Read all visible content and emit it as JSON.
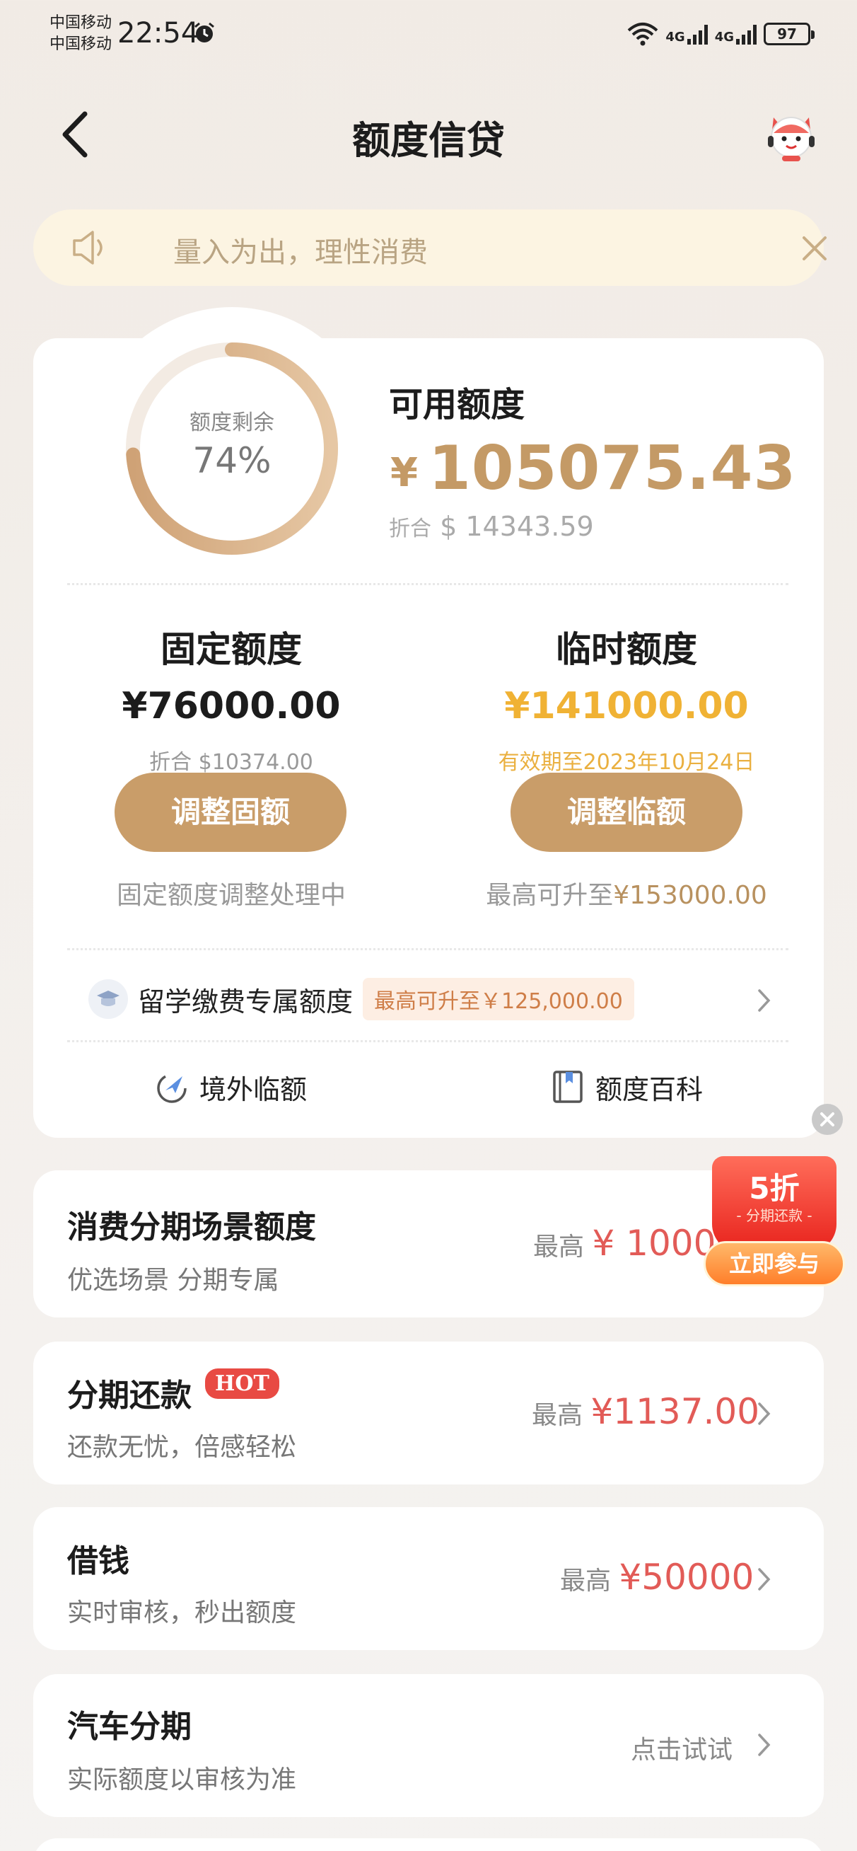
{
  "status_bar": {
    "carrier_1": "中国移动",
    "carrier_2": "中国移动",
    "time": "22:54",
    "net_1": "4G",
    "net_2": "4G",
    "battery": "97"
  },
  "nav": {
    "title": "额度信贷"
  },
  "notice": {
    "text": "量入为出，理性消费"
  },
  "overview": {
    "ring_label": "额度剩余",
    "ring_percent": "74%",
    "ring_fraction": 0.74,
    "available_label": "可用额度",
    "currency": "¥",
    "available_amount": "105075.43",
    "usd_prefix": "折合",
    "usd_amount": "$ 14343.59"
  },
  "fixed": {
    "title": "固定额度",
    "amount": "¥76000.00",
    "usd": "折合 $10374.00",
    "button": "调整固额",
    "note": "固定额度调整处理中"
  },
  "temporary": {
    "title": "临时额度",
    "amount": "¥141000.00",
    "validity_prefix": "有效期至",
    "validity_date": "2023年10月24日",
    "button": "调整临额",
    "note_prefix": "最高可升至",
    "note_amount": "¥153000.00"
  },
  "study_abroad": {
    "label": "留学缴费专属额度",
    "tag": "最高可升至￥125,000.00"
  },
  "links": {
    "overseas": "境外临额",
    "wiki": "额度百科"
  },
  "rows": [
    {
      "title": "消费分期场景额度",
      "subtitle": "优选场景 分期专属",
      "prefix": "最高",
      "amount": "¥ 10000"
    },
    {
      "title": "分期还款",
      "badge": "HOT",
      "subtitle": "还款无忧，倍感轻松",
      "prefix": "最高",
      "amount": "¥1137.00"
    },
    {
      "title": "借钱",
      "subtitle": "实时审核，秒出额度",
      "prefix": "最高",
      "amount": "¥50000"
    },
    {
      "title": "汽车分期",
      "subtitle": "实际额度以审核为准",
      "action": "点击试试"
    }
  ],
  "promo": {
    "discount": "5折",
    "subtitle": "- 分期还款 -",
    "button": "立即参与"
  },
  "colors": {
    "gold": "#c49a66",
    "button": "#c99d69",
    "red": "#e25b57",
    "temp_gold": "#f0b234",
    "notice_bg": "#fcf4e2"
  }
}
